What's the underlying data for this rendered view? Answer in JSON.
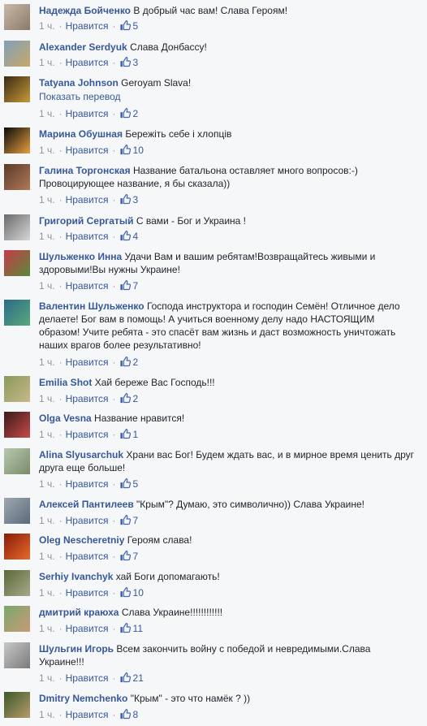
{
  "ui": {
    "time": "1 ч.",
    "like_label": "Нравится",
    "translate_label": "Показать перевод",
    "like_color": "#4267b2"
  },
  "comments": [
    {
      "author": "Надежда Бойченко",
      "text": "В добрый час вам! Слава Героям!",
      "likes": "5",
      "avatar": [
        "#c7b9a8",
        "#8a7a6a"
      ]
    },
    {
      "author": "Alexander Serdyuk",
      "text": "Слава Донбассу!",
      "likes": "3",
      "avatar": [
        "#7fa0b8",
        "#c9a86a"
      ]
    },
    {
      "author": "Tatyana Johnson",
      "text": "Geroyam Slava!",
      "likes": "2",
      "avatar": [
        "#3a2a12",
        "#c89a3a"
      ]
    },
    {
      "author": "Марина Обушная",
      "text": "Бережіть себе і хлопців",
      "likes": "10",
      "avatar": [
        "#0a0a0a",
        "#e8a040"
      ]
    },
    {
      "author": "Галина Торгонская",
      "text": "Название батальона оставляет много вопросов:-) Провоцирующее название, я бы сказала))",
      "likes": "3",
      "avatar": [
        "#5a3a2a",
        "#b07a5a"
      ]
    },
    {
      "author": "Григорий Сергатый",
      "text": "С вами - Бог и Украина !",
      "likes": "4",
      "avatar": [
        "#6a6a6a",
        "#d8d8d8"
      ]
    },
    {
      "author": "Шульженко Инна",
      "text": "Удачи Вам и вашим ребятам!Возвращайтесь живыми и здоровыми!Вы нужны Украине!",
      "likes": "7",
      "avatar": [
        "#c83a4a",
        "#5a8a3a"
      ]
    },
    {
      "author": "Валентин Шульженко",
      "text": "Господа инструктора и господин Семён! Отличное дело делаете! Бог вам в помощь! А учиться военному делу надо НАСТОЯЩИМ образом! Учите ребята - это спасёт вам жизнь и даст возможность уничтожать наших врагов более результативно!",
      "likes": "2",
      "avatar": [
        "#2a6a8a",
        "#5aaa7a"
      ]
    },
    {
      "author": "Emilia Shot",
      "text": "Хай береже Вас Господь!!!",
      "likes": "2",
      "avatar": [
        "#8a9a5a",
        "#c8b88a"
      ]
    },
    {
      "author": "Olga Vesna",
      "text": "Название нравится!",
      "likes": "1",
      "avatar": [
        "#3a1a1a",
        "#c84a4a"
      ]
    },
    {
      "author": "Alina Slyusarchuk",
      "text": "Храни вас Бог! Будем ждать вас, и в мирное время ценить друг друга еще больше!",
      "likes": "5",
      "avatar": [
        "#b8c8b0",
        "#7a8a6a"
      ]
    },
    {
      "author": "Алексей Пантилеев",
      "text": "\"Крым\"? Думаю, это символично)) Слава Украине!",
      "likes": "7",
      "avatar": [
        "#a0a8b0",
        "#5a6a7a"
      ]
    },
    {
      "author": "Oleg Nescheretniy",
      "text": "Героям слава!",
      "likes": "7",
      "avatar": [
        "#8a1a0a",
        "#e86a2a"
      ]
    },
    {
      "author": "Serhiy Ivanchyk",
      "text": "хай Боги допомагають!",
      "likes": "10",
      "avatar": [
        "#5a6a3a",
        "#a8a88a"
      ]
    },
    {
      "author": "дмитрий краюха",
      "text": "Слава Украине!!!!!!!!!!!!",
      "likes": "11",
      "avatar": [
        "#7aa86a",
        "#c89a7a"
      ]
    },
    {
      "author": "Шульгин Игорь",
      "text": "Всем закончить войну с победой и невредимыми.Слава Украине!!!",
      "likes": "21",
      "avatar": [
        "#c8c8c8",
        "#7a7a7a"
      ]
    },
    {
      "author": "Dmitry Nemchenko",
      "text": "\"Крым\" - это что намёк ? ))",
      "likes": "8",
      "avatar": [
        "#3a5a2a",
        "#b89a6a"
      ]
    }
  ]
}
